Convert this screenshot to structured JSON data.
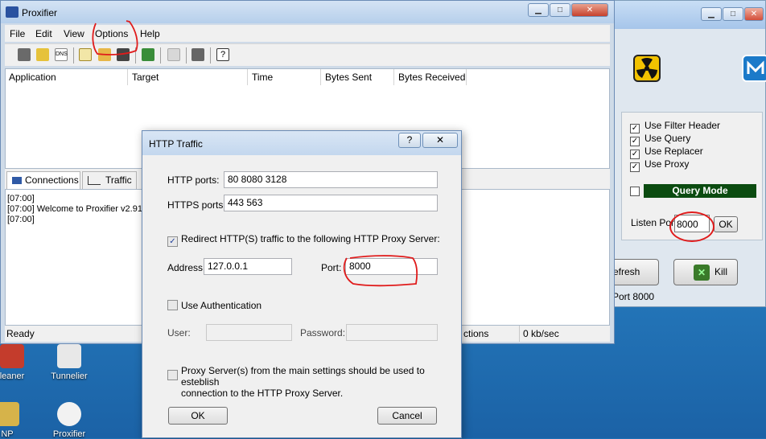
{
  "desktop": {
    "icons": [
      {
        "label": "leaner"
      },
      {
        "label": "Tunnelier"
      },
      {
        "label": "NP"
      },
      {
        "label": "Proxifier"
      }
    ]
  },
  "bg_app": {
    "checkboxes": [
      {
        "label": "Use Filter Header",
        "checked": true
      },
      {
        "label": "Use Query",
        "checked": true
      },
      {
        "label": "Use Replacer",
        "checked": true
      },
      {
        "label": "Use Proxy",
        "checked": true
      }
    ],
    "query_mode_label": "Query Mode",
    "listen_port_label": "Listen Port",
    "listen_port_value": "8000",
    "ok_label": "OK",
    "refresh_label": "efresh",
    "kill_label": "Kill",
    "status_text": "Port 8000"
  },
  "proxifier": {
    "title": "Proxifier",
    "menu": [
      "File",
      "Edit",
      "View",
      "Options",
      "Help"
    ],
    "columns": [
      "Application",
      "Target",
      "Time",
      "Bytes Sent",
      "Bytes Received"
    ],
    "tabs": [
      "Connections",
      "Traffic"
    ],
    "log": [
      "[07:00]",
      "[07:00]  Welcome to Proxifier v2.91",
      "[07:00]"
    ],
    "status": {
      "ready": "Ready",
      "connections": "ctions",
      "rate": "0 kb/sec"
    }
  },
  "dialog": {
    "title": "HTTP Traffic",
    "help_glyph": "?",
    "http_ports_label": "HTTP ports:",
    "http_ports_value": "80 8080 3128",
    "https_ports_label": "HTTPS ports:",
    "https_ports_value": "443 563",
    "redirect_label": "Redirect HTTP(S) traffic to the following HTTP Proxy Server:",
    "redirect_checked": true,
    "address_label": "Address:",
    "address_value": "127.0.0.1",
    "port_label": "Port:",
    "port_value": "8000",
    "use_auth_label": "Use Authentication",
    "use_auth_checked": false,
    "user_label": "User:",
    "password_label": "Password:",
    "proxy_servers_line1": "Proxy Server(s) from the main settings should be used to esteblish",
    "proxy_servers_line2": "connection to the HTTP Proxy Server.",
    "ok_label": "OK",
    "cancel_label": "Cancel"
  }
}
